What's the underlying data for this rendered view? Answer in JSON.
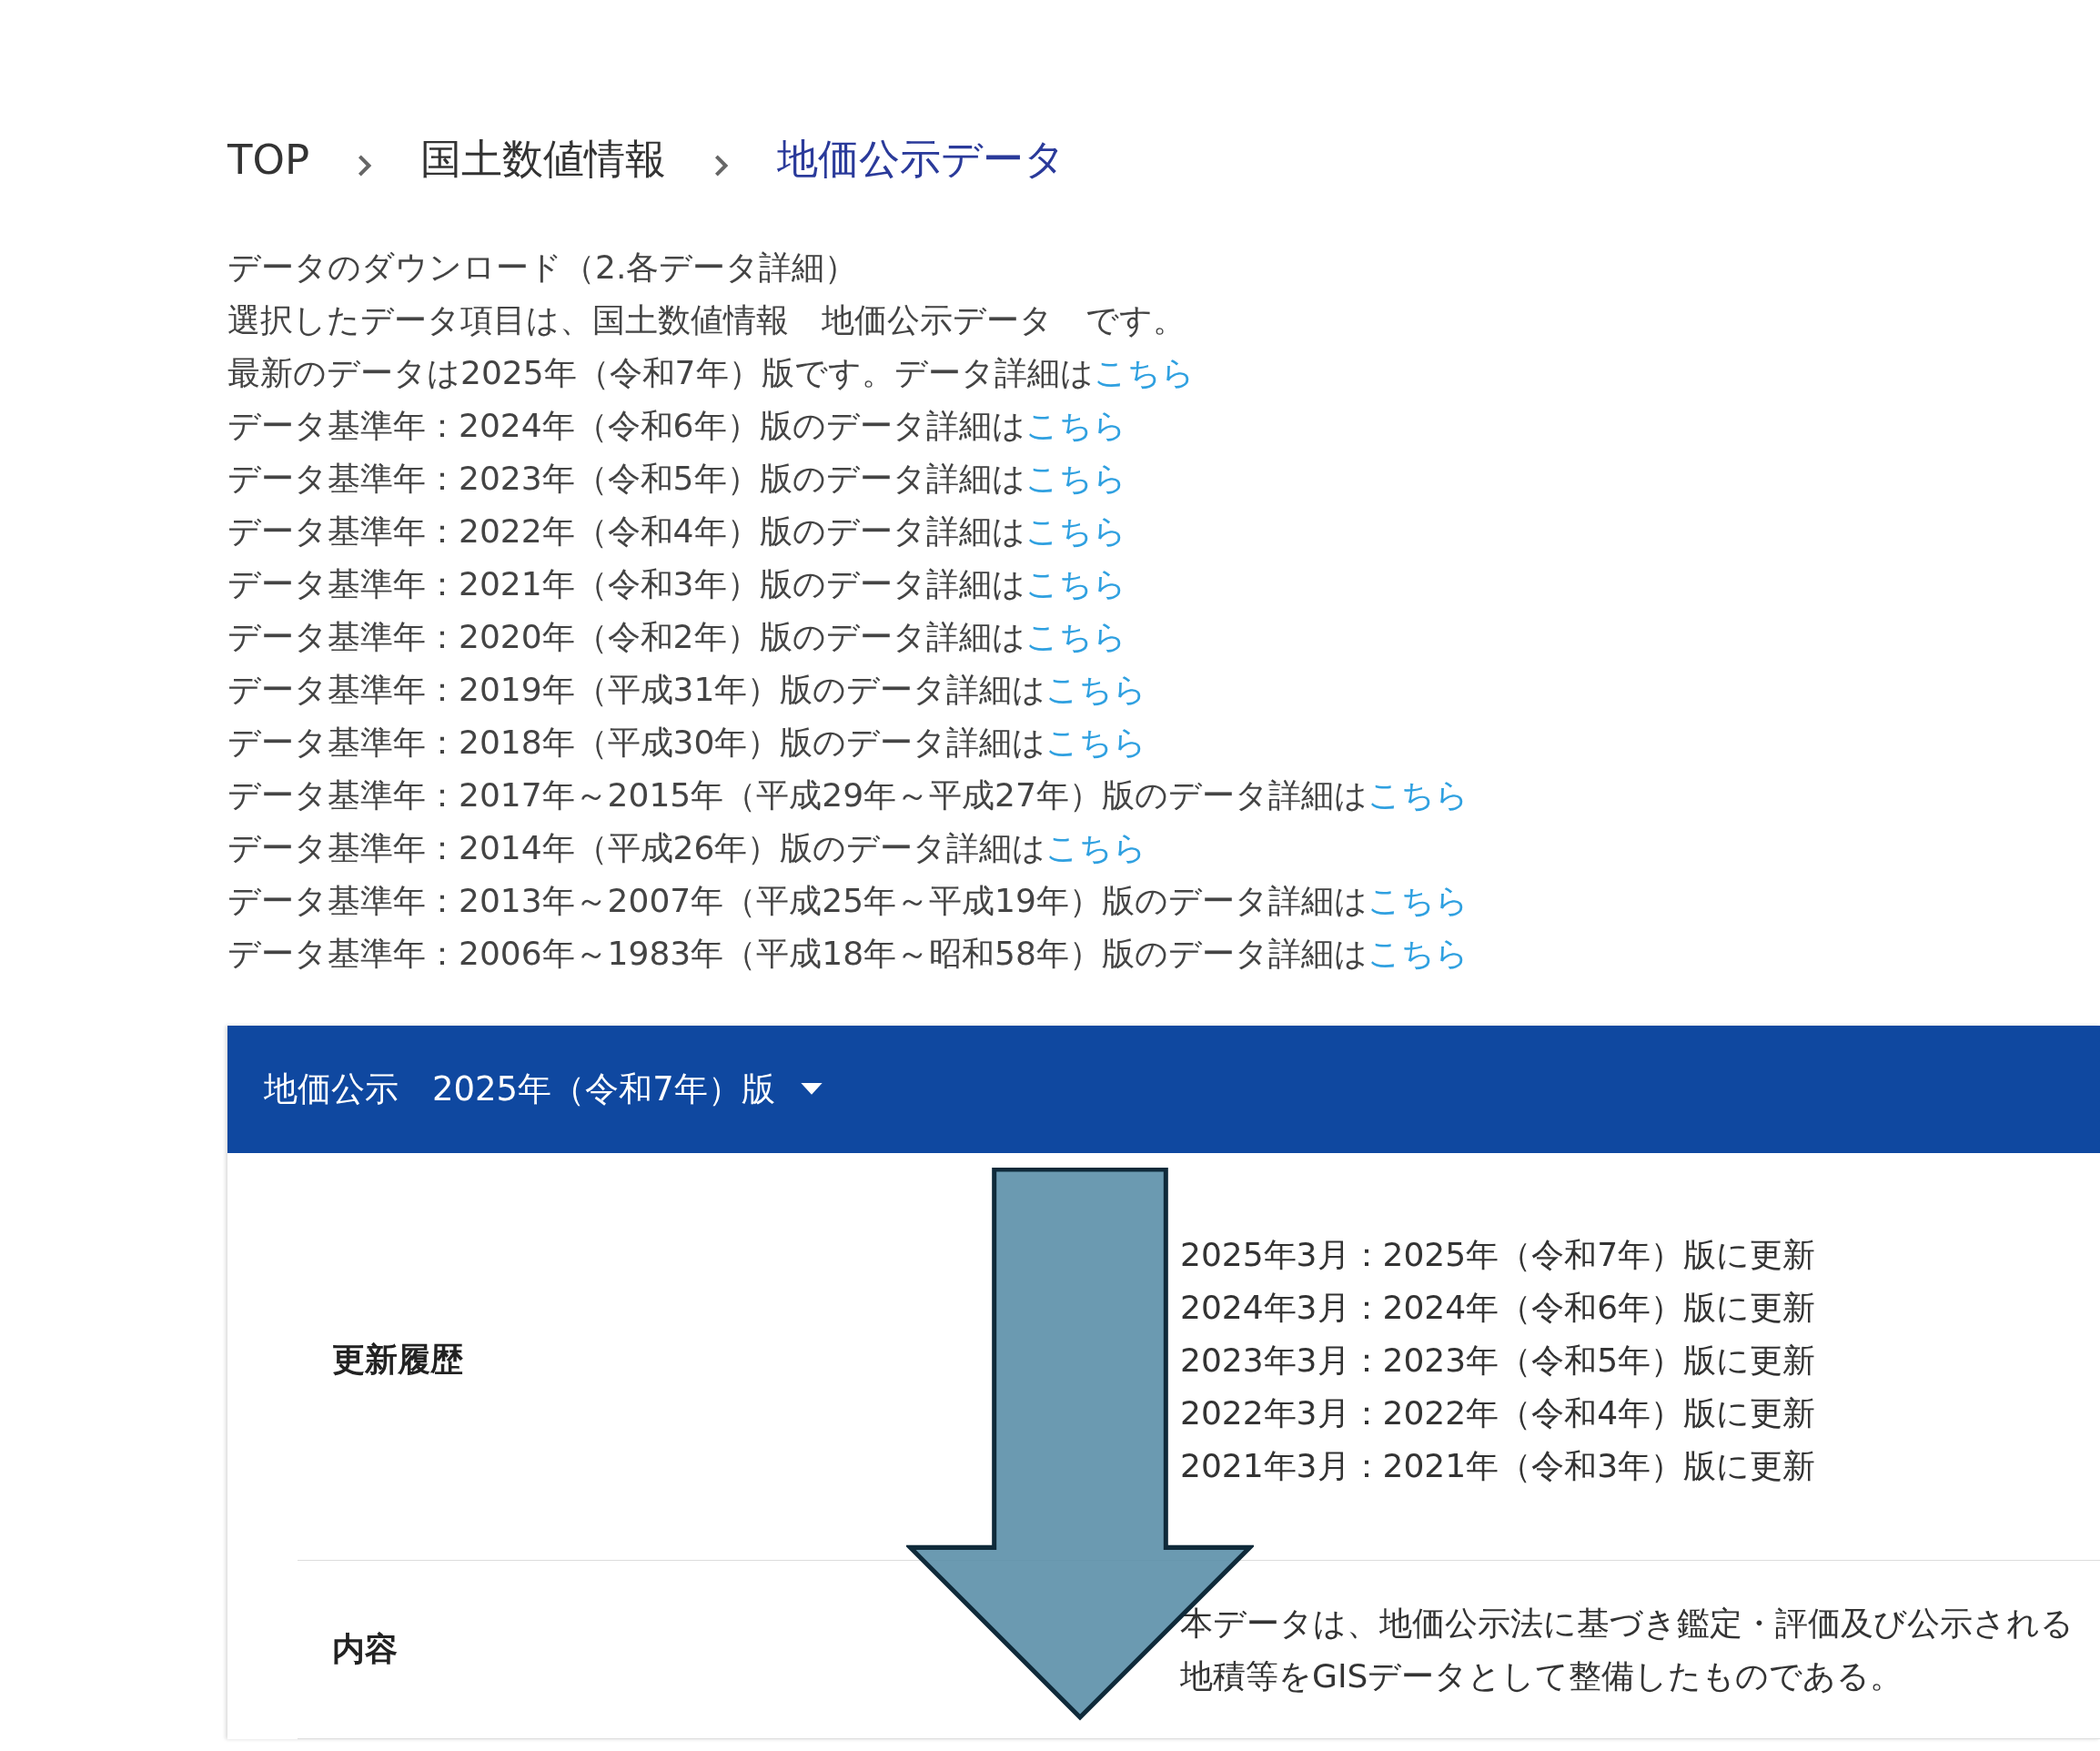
{
  "breadcrumb": [
    {
      "label": "TOP",
      "current": false
    },
    {
      "label": "国土数値情報",
      "current": false
    },
    {
      "label": "地価公示データ",
      "current": true
    }
  ],
  "intro": [
    "データのダウンロード（2.各データ詳細）",
    "選択したデータ項目は、国土数値情報　地価公示データ　です。"
  ],
  "detail_links": [
    {
      "text": "最新のデータは2025年（令和7年）版です。データ詳細は",
      "link": "こちら"
    },
    {
      "text": "データ基準年：2024年（令和6年）版のデータ詳細は",
      "link": "こちら"
    },
    {
      "text": "データ基準年：2023年（令和5年）版のデータ詳細は",
      "link": "こちら"
    },
    {
      "text": "データ基準年：2022年（令和4年）版のデータ詳細は",
      "link": "こちら"
    },
    {
      "text": "データ基準年：2021年（令和3年）版のデータ詳細は",
      "link": "こちら"
    },
    {
      "text": "データ基準年：2020年（令和2年）版のデータ詳細は",
      "link": "こちら"
    },
    {
      "text": "データ基準年：2019年（平成31年）版のデータ詳細は",
      "link": "こちら"
    },
    {
      "text": "データ基準年：2018年（平成30年）版のデータ詳細は",
      "link": "こちら"
    },
    {
      "text": "データ基準年：2017年～2015年（平成29年～平成27年）版のデータ詳細は",
      "link": "こちら"
    },
    {
      "text": "データ基準年：2014年（平成26年）版のデータ詳細は",
      "link": "こちら"
    },
    {
      "text": "データ基準年：2013年～2007年（平成25年～平成19年）版のデータ詳細は",
      "link": "こちら"
    },
    {
      "text": "データ基準年：2006年～1983年（平成18年～昭和58年）版のデータ詳細は",
      "link": "こちら"
    }
  ],
  "panel": {
    "title": "地価公示　2025年（令和7年）版",
    "rows": [
      {
        "label": "更新履歴",
        "lines": [
          "2025年3月：2025年（令和7年）版に更新",
          "2024年3月：2024年（令和6年）版に更新",
          "2023年3月：2023年（令和5年）版に更新",
          "2022年3月：2022年（令和4年）版に更新",
          "2021年3月：2021年（令和3年）版に更新"
        ]
      },
      {
        "label": "内容",
        "lines": [
          "本データは、地価公示法に基づき鑑定・評価及び公示される",
          "地積等をGISデータとして整備したものである。"
        ]
      }
    ]
  }
}
